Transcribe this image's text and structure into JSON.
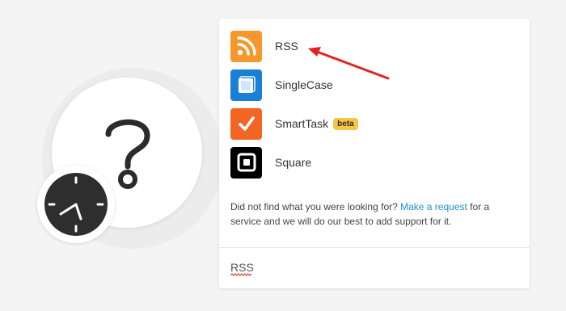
{
  "apps": [
    {
      "label": "RSS",
      "icon": "rss-icon",
      "color": "#f7962a"
    },
    {
      "label": "SingleCase",
      "icon": "singlecase-icon",
      "color": "#1a7fd6"
    },
    {
      "label": "SmartTask",
      "icon": "smarttask-checkmark-icon",
      "color": "#f26522",
      "badge": "beta"
    },
    {
      "label": "Square",
      "icon": "square-icon",
      "color": "#000000"
    }
  ],
  "help": {
    "before": "Did not find what you were looking for? ",
    "link": "Make a request",
    "after": " for a service and we will do our best to add support for it."
  },
  "search": {
    "value": "RSS"
  },
  "colors": {
    "accent_link": "#1e8fd3",
    "beta_badge": "#f6c544",
    "annotation_arrow": "#e02424"
  }
}
